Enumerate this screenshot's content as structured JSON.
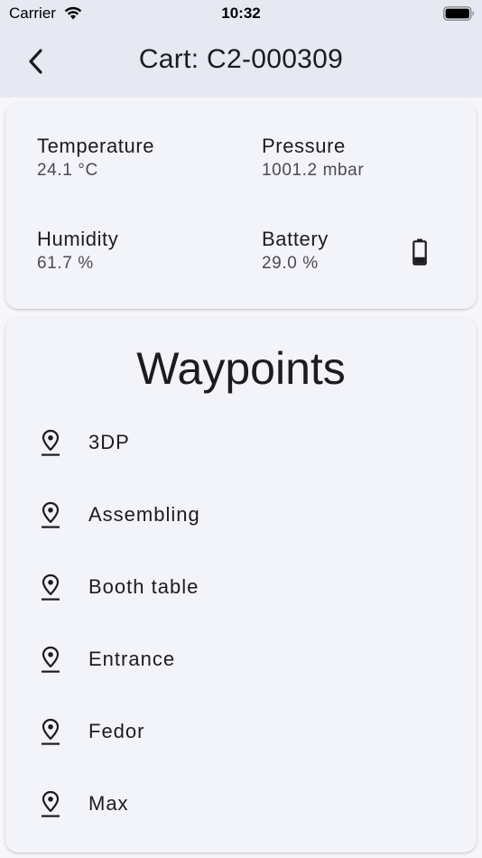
{
  "status_bar": {
    "carrier": "Carrier",
    "time": "10:32",
    "icons": [
      "wifi-icon",
      "battery-status-icon"
    ]
  },
  "app_bar": {
    "back_icon": "chevron-left-icon",
    "title": "Cart: C2-000309"
  },
  "sensors": {
    "temperature": {
      "label": "Temperature",
      "value": "24.1 °C"
    },
    "pressure": {
      "label": "Pressure",
      "value": "1001.2 mbar"
    },
    "humidity": {
      "label": "Humidity",
      "value": "61.7 %"
    },
    "battery": {
      "label": "Battery",
      "value": "29.0 %",
      "icon": "battery-icon",
      "level": 0.29
    }
  },
  "waypoints": {
    "title": "Waypoints",
    "icon": "location-pin-icon",
    "items": [
      {
        "label": "3DP"
      },
      {
        "label": "Assembling"
      },
      {
        "label": "Booth table"
      },
      {
        "label": "Entrance"
      },
      {
        "label": "Fedor"
      },
      {
        "label": "Max"
      }
    ]
  },
  "colors": {
    "app_bar_bg": "#e6e8f2",
    "card_bg": "#f3f3fa",
    "page_bg": "#f6f6fb",
    "text_primary": "#1c1b1f",
    "text_secondary": "#4a4a52"
  }
}
